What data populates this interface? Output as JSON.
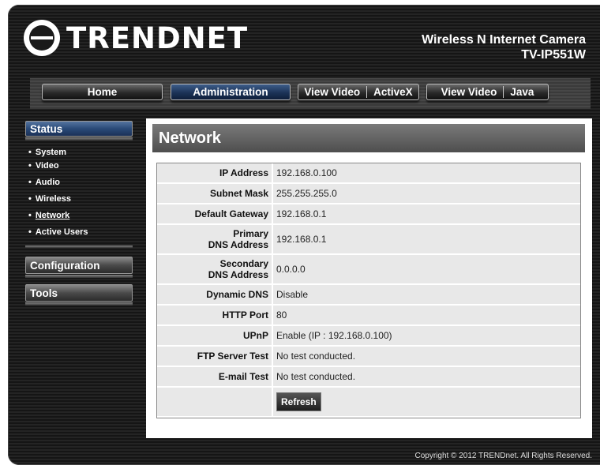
{
  "header": {
    "logo_text": "TRENDNET",
    "product_name": "Wireless N Internet Camera",
    "model": "TV-IP551W"
  },
  "nav": {
    "home": "Home",
    "administration": "Administration",
    "view_video_activex": [
      "View Video",
      "ActiveX"
    ],
    "view_video_java": [
      "View Video",
      "Java"
    ]
  },
  "sidebar": {
    "status": "Status",
    "items": [
      "System",
      "Video",
      "Audio",
      "Wireless",
      "Network",
      "Active Users"
    ],
    "configuration": "Configuration",
    "tools": "Tools"
  },
  "main": {
    "title": "Network",
    "rows": [
      {
        "label": "IP Address",
        "value": "192.168.0.100"
      },
      {
        "label": "Subnet Mask",
        "value": "255.255.255.0"
      },
      {
        "label": "Default Gateway",
        "value": "192.168.0.1"
      },
      {
        "label_1": "Primary",
        "label_2": "DNS Address",
        "value": "192.168.0.1"
      },
      {
        "label_1": "Secondary",
        "label_2": "DNS Address",
        "value": "0.0.0.0"
      },
      {
        "label": "Dynamic DNS",
        "value": "Disable"
      },
      {
        "label": "HTTP Port",
        "value": "80"
      },
      {
        "label": "UPnP",
        "value": "Enable (IP : 192.168.0.100)"
      },
      {
        "label": "FTP Server Test",
        "value": "No test conducted."
      },
      {
        "label": "E-mail Test",
        "value": "No test conducted."
      }
    ],
    "refresh_label": "Refresh"
  },
  "footer": {
    "copyright": "Copyright © 2012 TRENDnet.  All Rights Reserved."
  }
}
